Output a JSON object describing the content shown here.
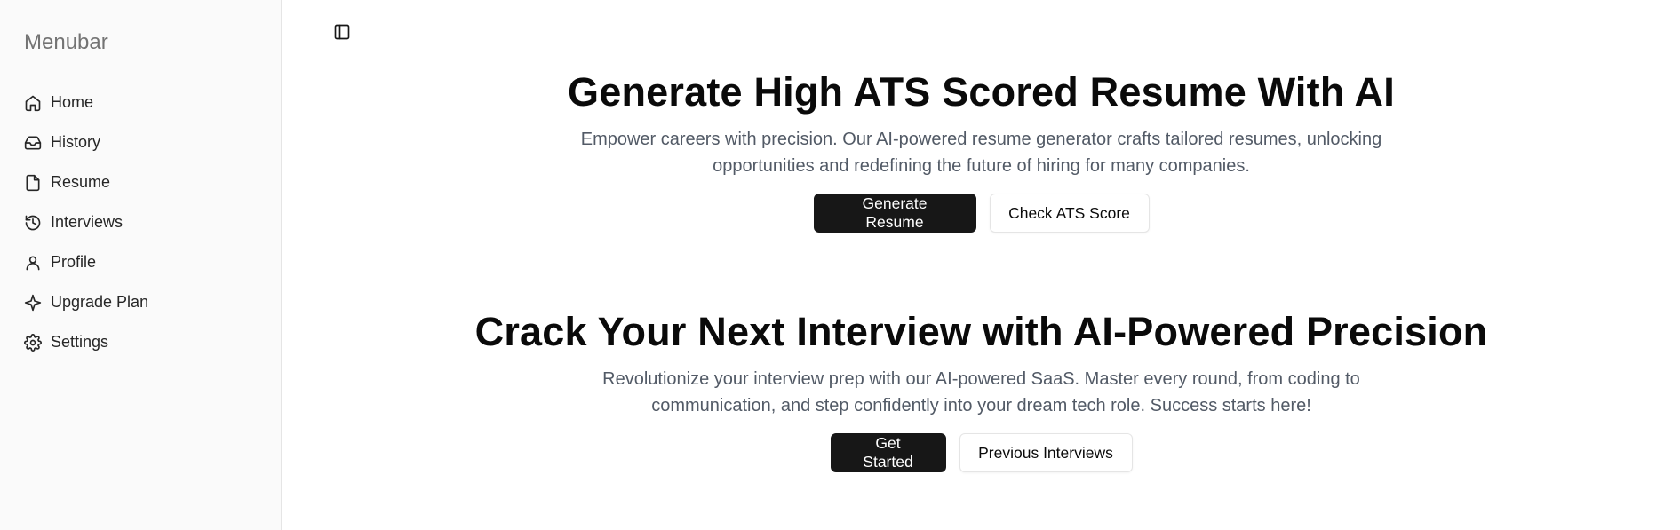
{
  "sidebar": {
    "title": "Menubar",
    "items": [
      {
        "label": "Home",
        "icon": "home-icon"
      },
      {
        "label": "History",
        "icon": "inbox-icon"
      },
      {
        "label": "Resume",
        "icon": "file-icon"
      },
      {
        "label": "Interviews",
        "icon": "history-icon"
      },
      {
        "label": "Profile",
        "icon": "user-icon"
      },
      {
        "label": "Upgrade Plan",
        "icon": "sparkle-icon"
      },
      {
        "label": "Settings",
        "icon": "gear-icon"
      }
    ]
  },
  "header": {
    "toggle_icon": "sidebar-toggle-icon"
  },
  "resume_section": {
    "title": "Generate High ATS Scored Resume With AI",
    "description": "Empower careers with precision. Our AI-powered resume generator crafts tailored resumes, unlocking opportunities and redefining the future of hiring for many companies.",
    "primary_button": "Generate Resume",
    "secondary_button": "Check ATS Score"
  },
  "interview_section": {
    "title": "Crack Your Next Interview with AI-Powered Precision",
    "description": "Revolutionize your interview prep with our AI-powered SaaS. Master every round, from coding to communication, and step confidently into your dream tech role. Success starts here!",
    "primary_button": "Get Started",
    "secondary_button": "Previous Interviews"
  },
  "colors": {
    "primary_button_bg": "#171717",
    "sidebar_bg": "#fafafa",
    "description_text": "#525a66"
  }
}
